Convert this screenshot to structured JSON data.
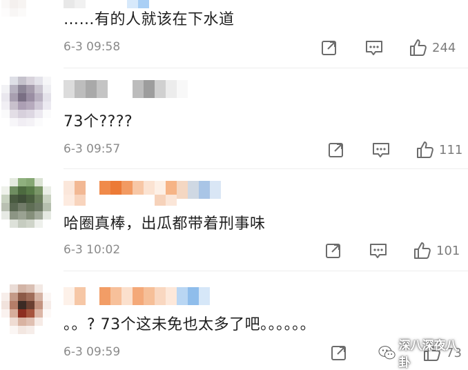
{
  "comments": [
    {
      "text": "……有的人就该在下水道",
      "time": "6-3 09:58",
      "likes": "244"
    },
    {
      "text": "73个????",
      "time": "6-3 09:57",
      "likes": "111"
    },
    {
      "text": "哈圈真棒，出瓜都带着刑事味",
      "time": "6-3 10:02",
      "likes": "101"
    },
    {
      "text": "。。? 73个这未免也太多了吧。。。。。。",
      "time": "6-3 09:59",
      "likes": "73"
    }
  ],
  "icons": {
    "share": "share-icon",
    "reply": "comment-icon",
    "like": "thumbs-up-icon"
  },
  "watermark": {
    "text": "深八深夜八卦"
  },
  "colors": {
    "text": "#1f1f1f",
    "meta": "#8a8a8a",
    "icon": "#6b6b6b"
  }
}
